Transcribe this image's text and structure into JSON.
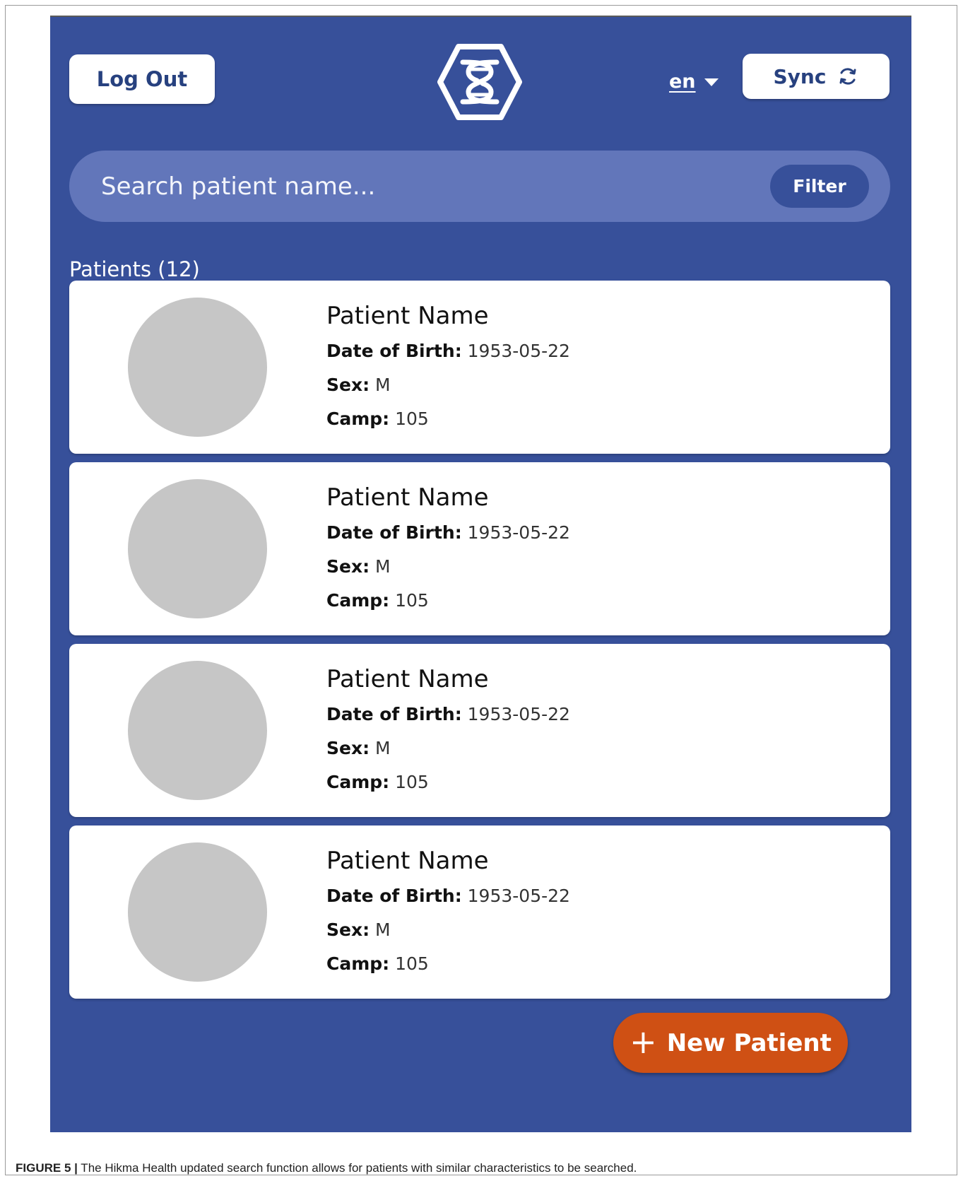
{
  "header": {
    "logout_label": "Log Out",
    "language": "en",
    "sync_label": "Sync"
  },
  "search": {
    "placeholder": "Search patient name...",
    "filter_label": "Filter"
  },
  "patients_heading": "Patients (12)",
  "patients": [
    {
      "name": "Patient Name",
      "dob_label": "Date of Birth:",
      "dob": "1953-05-22",
      "sex_label": "Sex:",
      "sex": "M",
      "camp_label": "Camp:",
      "camp": "105"
    },
    {
      "name": "Patient Name",
      "dob_label": "Date of Birth:",
      "dob": "1953-05-22",
      "sex_label": "Sex:",
      "sex": "M",
      "camp_label": "Camp:",
      "camp": "105"
    },
    {
      "name": "Patient Name",
      "dob_label": "Date of Birth:",
      "dob": "1953-05-22",
      "sex_label": "Sex:",
      "sex": "M",
      "camp_label": "Camp:",
      "camp": "105"
    },
    {
      "name": "Patient Name",
      "dob_label": "Date of Birth:",
      "dob": "1953-05-22",
      "sex_label": "Sex:",
      "sex": "M",
      "camp_label": "Camp:",
      "camp": "105"
    }
  ],
  "new_patient_label": "New Patient",
  "caption": {
    "label": "FIGURE 5 |",
    "text": " The Hikma Health updated search function allows for patients with similar characteristics to be searched."
  },
  "colors": {
    "background": "#37509a",
    "search_bar": "#6276ba",
    "new_patient": "#cf5014",
    "avatar": "#c6c6c6"
  },
  "icons": {
    "logo": "hikma-health-logo",
    "sync": "sync-icon",
    "language_dropdown": "chevron-down-icon",
    "add": "plus-icon"
  }
}
